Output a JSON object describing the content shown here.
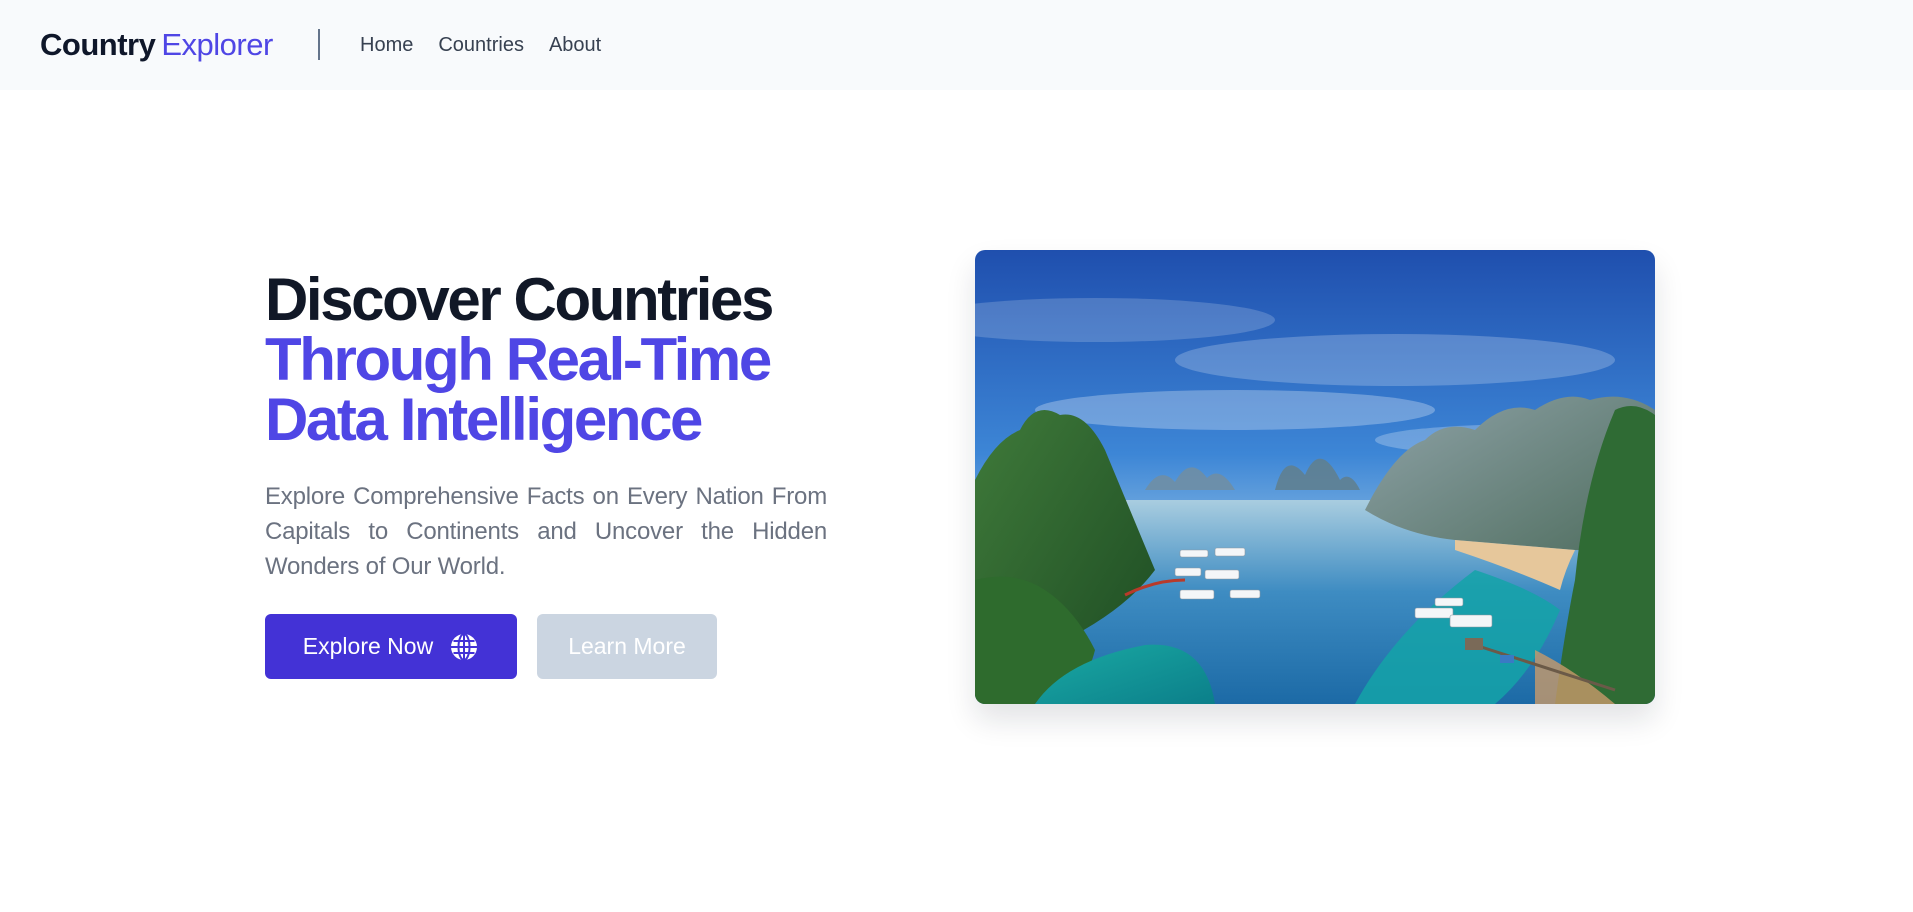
{
  "nav": {
    "brand_strong": "Country",
    "brand_light": "Explorer",
    "links": [
      "Home",
      "Countries",
      "About"
    ]
  },
  "hero": {
    "headline_line1": "Discover Countries",
    "headline_line2": "Through Real-Time",
    "headline_line3": "Data Intelligence",
    "subtext": "Explore Comprehensive Facts on Every Nation From Capitals to Continents and Uncover the Hidden Wonders of Our World.",
    "primary_button": "Explore Now",
    "secondary_button": "Learn More",
    "image_icon": "bay-landscape-photo"
  },
  "colors": {
    "accent": "#4f46e5",
    "primary_button": "#4332d6",
    "secondary_button": "#cbd5e1",
    "heading": "#111827",
    "body_text": "#6b7280",
    "nav_bg": "#f8fafc"
  },
  "icons": {
    "primary_button_icon": "globe-icon"
  }
}
